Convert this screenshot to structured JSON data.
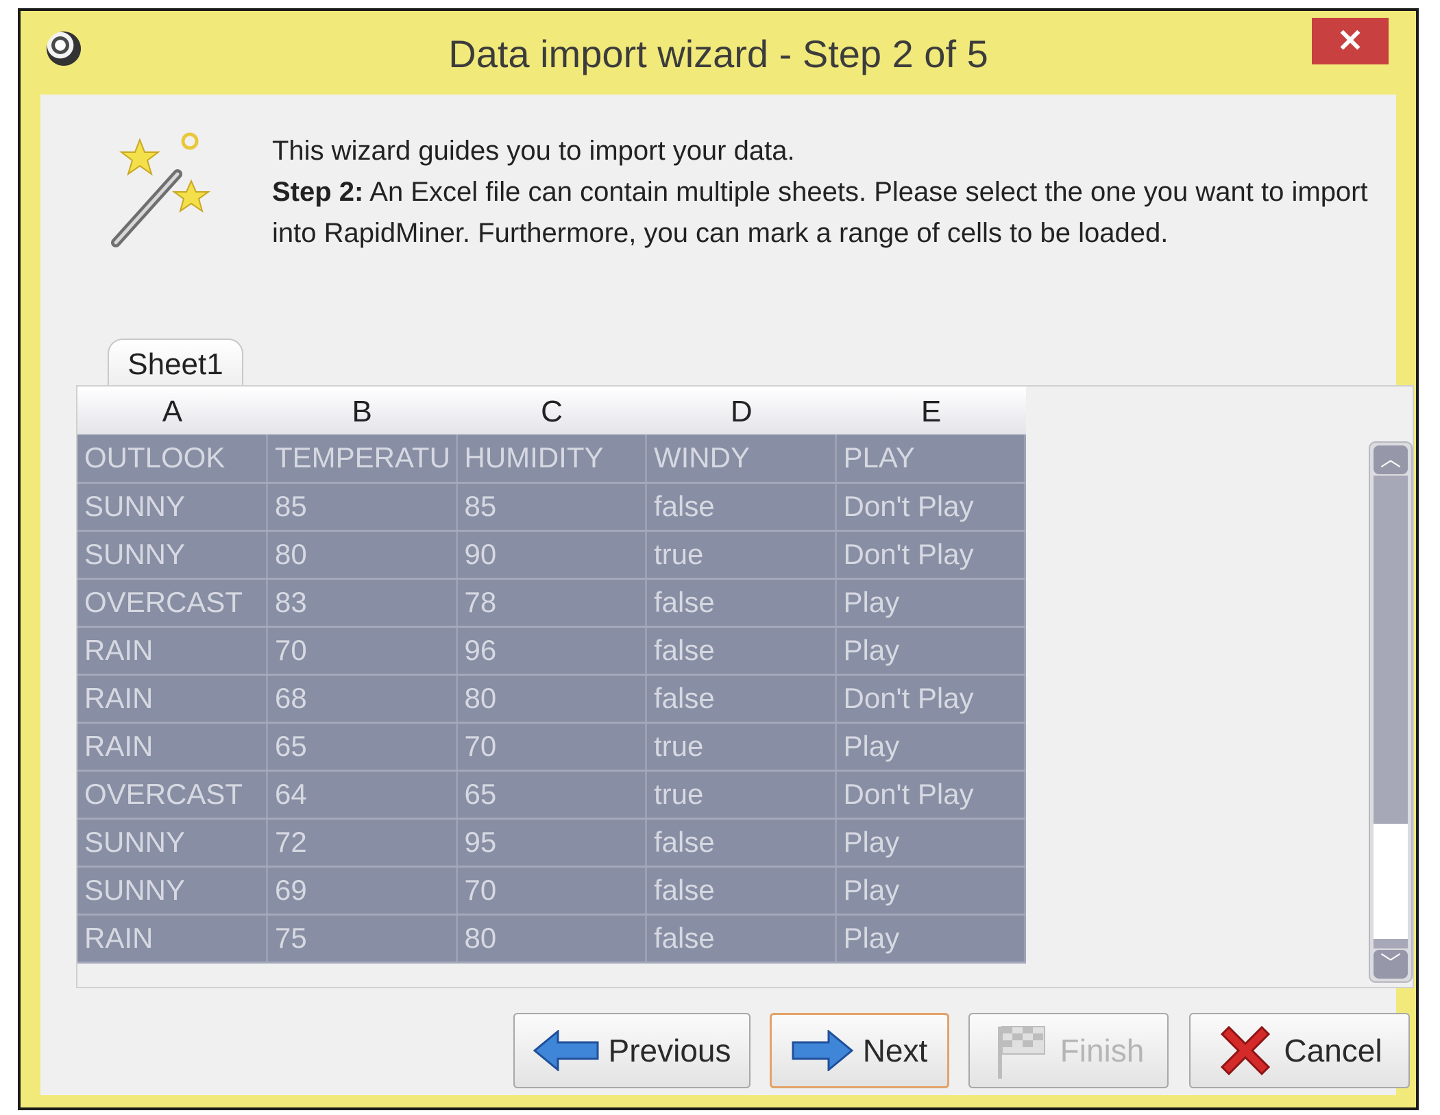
{
  "window": {
    "title": "Data import wizard - Step 2 of 5",
    "close_glyph": "✕",
    "colors": {
      "frame": "#f1ea7b",
      "selection": "#888ea3",
      "close": "#c94040"
    }
  },
  "intro": {
    "line1": "This wizard guides you to import your data.",
    "step_label": "Step 2:",
    "step_text": " An Excel file can contain multiple sheets. Please select the one you want to import into RapidMiner. Furthermore, you can mark a range of cells to be loaded."
  },
  "sheet_tab": {
    "label": "Sheet1"
  },
  "grid": {
    "column_letters": [
      "A",
      "B",
      "C",
      "D",
      "E"
    ],
    "rows": [
      [
        "OUTLOOK",
        "TEMPERATU",
        "HUMIDITY",
        "WINDY",
        "PLAY"
      ],
      [
        "SUNNY",
        "85",
        "85",
        "false",
        "Don't Play"
      ],
      [
        "SUNNY",
        "80",
        "90",
        "true",
        "Don't Play"
      ],
      [
        "OVERCAST",
        "83",
        "78",
        "false",
        "Play"
      ],
      [
        "RAIN",
        "70",
        "96",
        "false",
        "Play"
      ],
      [
        "RAIN",
        "68",
        "80",
        "false",
        "Don't Play"
      ],
      [
        "RAIN",
        "65",
        "70",
        "true",
        "Play"
      ],
      [
        "OVERCAST",
        "64",
        "65",
        "true",
        "Don't Play"
      ],
      [
        "SUNNY",
        "72",
        "95",
        "false",
        "Play"
      ],
      [
        "SUNNY",
        "69",
        "70",
        "false",
        "Play"
      ],
      [
        "RAIN",
        "75",
        "80",
        "false",
        "Play"
      ]
    ]
  },
  "scrollbar": {
    "up_glyph": "︿",
    "down_glyph": "﹀"
  },
  "buttons": {
    "previous": "Previous",
    "next": "Next",
    "finish": "Finish",
    "cancel": "Cancel"
  },
  "icons": {
    "app": "rapidminer-icon",
    "wizard": "magic-wand-icon",
    "previous": "arrow-left-icon",
    "next": "arrow-right-icon",
    "finish": "checkered-flag-icon",
    "cancel": "red-x-icon"
  }
}
